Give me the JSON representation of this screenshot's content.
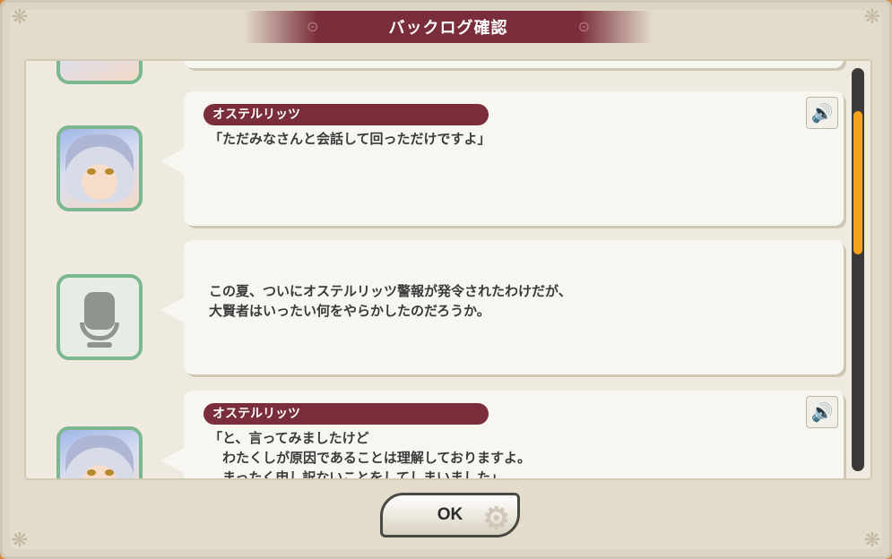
{
  "window": {
    "title": "バックログ確認"
  },
  "entries": [
    {
      "speaker": "オステルリッツ",
      "text": "「ただみなさんと会話して回っただけですよ」",
      "voice_icon": "speaker-icon",
      "portrait": "character-portrait"
    },
    {
      "speaker": "",
      "text": "この夏、ついにオステルリッツ警報が発令されたわけだが、\n大賢者はいったい何をやらかしたのだろうか。",
      "voice_icon": "",
      "portrait": "narrator-mic-icon"
    },
    {
      "speaker": "オステルリッツ",
      "text": "「と、言ってみましたけど\n　わたくしが原因であることは理解しておりますよ。\n　まったく申し訳ないことをしてしまいました」",
      "voice_icon": "speaker-icon",
      "portrait": "character-portrait"
    }
  ],
  "footer": {
    "ok_label": "OK"
  },
  "scroll": {
    "position_fraction": 0.25
  },
  "colors": {
    "accent": "#7a2d3a",
    "portrait_border": "#7bb78f",
    "scroll_thumb": "#f4a21c"
  }
}
